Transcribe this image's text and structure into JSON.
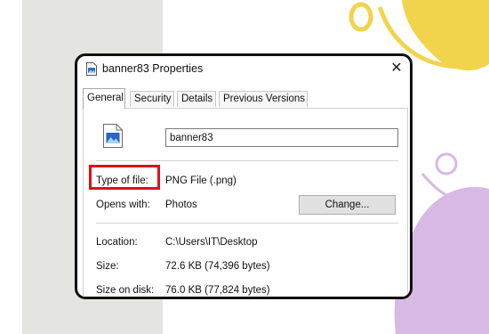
{
  "window": {
    "title": "banner83 Properties",
    "close_symbol": "✕"
  },
  "tabs": [
    {
      "label": "General",
      "active": true
    },
    {
      "label": "Security",
      "active": false
    },
    {
      "label": "Details",
      "active": false
    },
    {
      "label": "Previous Versions",
      "active": false
    }
  ],
  "general": {
    "file_name": "banner83",
    "type_of_file_label": "Type of file:",
    "type_of_file_value": "PNG File (.png)",
    "opens_with_label": "Opens with:",
    "opens_with_value": "Photos",
    "change_button": "Change...",
    "location_label": "Location:",
    "location_value": "C:\\Users\\IT\\Desktop",
    "size_label": "Size:",
    "size_value": "72.6 KB (74,396 bytes)",
    "size_on_disk_label": "Size on disk:",
    "size_on_disk_value": "76.0 KB (77,824 bytes)"
  },
  "icons": {
    "title": "image-file-icon",
    "file": "image-file-icon",
    "close": "close-icon"
  },
  "colors": {
    "highlight": "#e0101a",
    "decor_yellow": "#f2d44c",
    "decor_purple": "#d7b9e3",
    "decor_grey": "#e4e4e1"
  }
}
